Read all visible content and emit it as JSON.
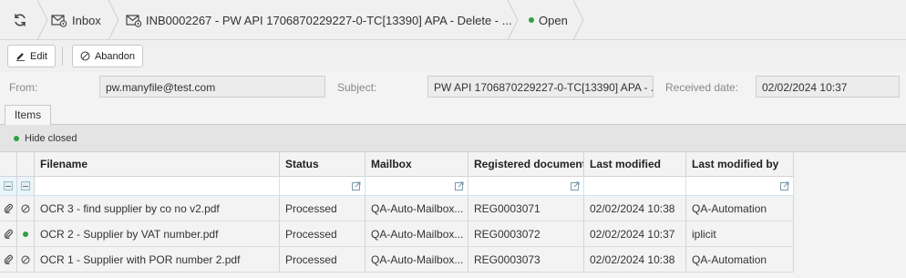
{
  "breadcrumb": {
    "inbox_label": "Inbox",
    "document_label": "INB0002267 - PW API 1706870229227-0-TC[13390] APA - Delete - ...",
    "status_label": "Open",
    "status_color": "#2ea043"
  },
  "toolbar": {
    "edit_label": "Edit",
    "abandon_label": "Abandon"
  },
  "form": {
    "from_label": "From:",
    "from_value": "pw.manyfile@test.com",
    "subject_label": "Subject:",
    "subject_value": "PW API 1706870229227-0-TC[13390] APA - ...",
    "received_label": "Received date:",
    "received_value": "02/02/2024 10:37"
  },
  "tabs": {
    "items_label": "Items"
  },
  "filter": {
    "hide_closed_label": "Hide closed"
  },
  "grid": {
    "columns": [
      "Filename",
      "Status",
      "Mailbox",
      "Registered document",
      "Last modified",
      "Last modified by"
    ],
    "rows": [
      {
        "state": "abandoned",
        "filename": "OCR 3 - find supplier by co no v2.pdf",
        "status": "Processed",
        "mailbox": "QA-Auto-Mailbox...",
        "registered": "REG0003071",
        "modified": "02/02/2024 10:38",
        "modified_by": "QA-Automation"
      },
      {
        "state": "open",
        "filename": "OCR 2 - Supplier by VAT number.pdf",
        "status": "Processed",
        "mailbox": "QA-Auto-Mailbox...",
        "registered": "REG0003072",
        "modified": "02/02/2024 10:37",
        "modified_by": "iplicit"
      },
      {
        "state": "abandoned",
        "filename": "OCR 1 - Supplier with POR number 2.pdf",
        "status": "Processed",
        "mailbox": "QA-Auto-Mailbox...",
        "registered": "REG0003073",
        "modified": "02/02/2024 10:38",
        "modified_by": "QA-Automation"
      }
    ]
  },
  "icons": [
    "refresh-icon",
    "inbox-icon",
    "mail-icon",
    "pencil-icon",
    "abandon-icon",
    "paperclip-icon",
    "expand-icon"
  ]
}
